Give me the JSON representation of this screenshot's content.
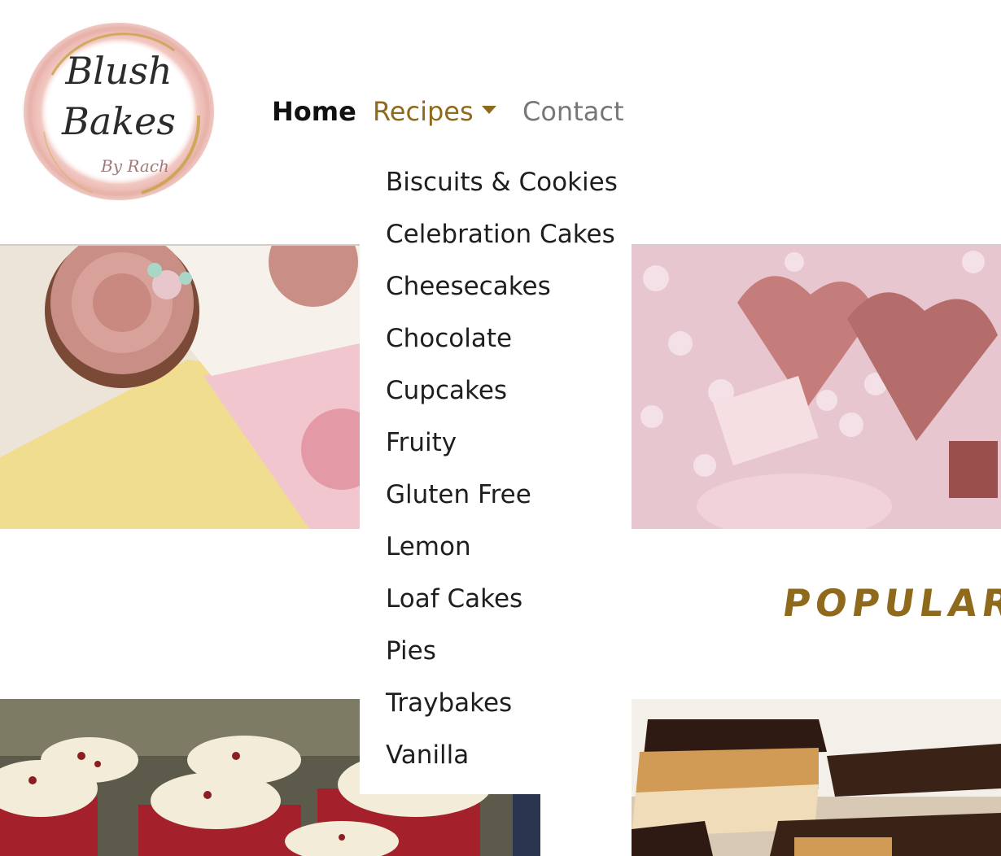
{
  "logo": {
    "line1": "Blush",
    "line2": "Bakes",
    "line3": "By Rach"
  },
  "nav": {
    "home": "Home",
    "recipes": "Recipes",
    "contact": "Contact"
  },
  "dropdown": {
    "items": [
      "Biscuits & Cookies",
      "Celebration Cakes",
      "Cheesecakes",
      "Chocolate",
      "Cupcakes",
      "Fruity",
      "Gluten Free",
      "Lemon",
      "Loaf Cakes",
      "Pies",
      "Traybakes",
      "Vanilla"
    ]
  },
  "popular": {
    "title": "POPULAR RE"
  },
  "colors": {
    "accent_gold": "#8f6a1c",
    "text_dark": "#1e1e1e",
    "nav_inactive": "#777777"
  }
}
